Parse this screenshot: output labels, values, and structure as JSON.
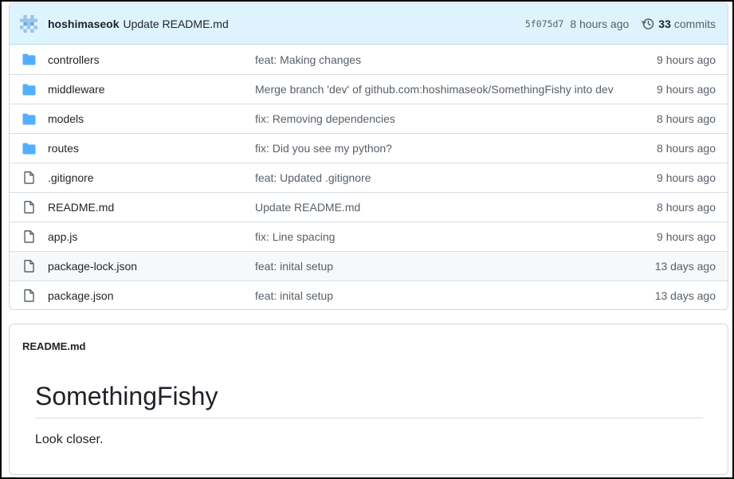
{
  "commit": {
    "user": "hoshimaseok",
    "message": "Update README.md",
    "sha": "5f075d7",
    "age": "8 hours ago",
    "count": "33",
    "count_label": "commits"
  },
  "files": [
    {
      "name": "controllers",
      "type": "folder",
      "message": "feat: Making changes",
      "age": "9 hours ago"
    },
    {
      "name": "middleware",
      "type": "folder",
      "message": "Merge branch 'dev' of github.com:hoshimaseok/SomethingFishy into dev",
      "age": "9 hours ago"
    },
    {
      "name": "models",
      "type": "folder",
      "message": "fix: Removing dependencies",
      "age": "8 hours ago"
    },
    {
      "name": "routes",
      "type": "folder",
      "message": "fix: Did you see my python?",
      "age": "8 hours ago"
    },
    {
      "name": ".gitignore",
      "type": "file",
      "message": "feat: Updated .gitignore",
      "age": "9 hours ago"
    },
    {
      "name": "README.md",
      "type": "file",
      "message": "Update README.md",
      "age": "8 hours ago"
    },
    {
      "name": "app.js",
      "type": "file",
      "message": "fix: Line spacing",
      "age": "9 hours ago"
    },
    {
      "name": "package-lock.json",
      "type": "file",
      "message": "feat: inital setup",
      "age": "13 days ago"
    },
    {
      "name": "package.json",
      "type": "file",
      "message": "feat: inital setup",
      "age": "13 days ago"
    }
  ],
  "readme": {
    "filename": "README.md",
    "title": "SomethingFishy",
    "body": "Look closer."
  },
  "colors": {
    "commit_bar_bg": "#ddf4ff",
    "folder_icon": "#54aeff",
    "file_icon": "#57606a",
    "muted_text": "#57606a"
  },
  "icons": {
    "folder": "folder-icon",
    "file": "file-icon",
    "history": "history-icon",
    "avatar": "identicon-avatar"
  }
}
